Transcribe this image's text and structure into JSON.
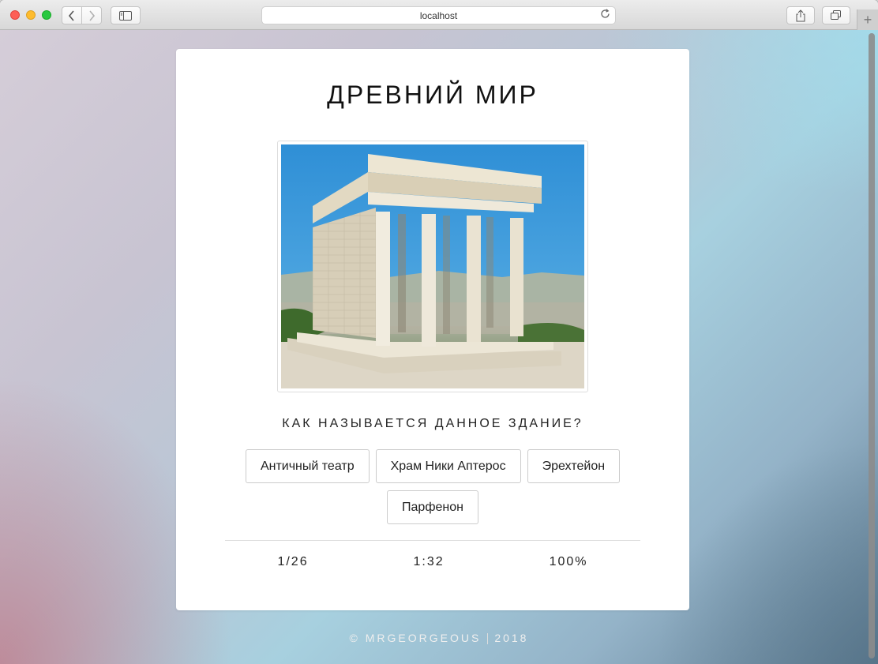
{
  "browser": {
    "address": "localhost",
    "icons": {
      "back": "chevron-left-icon",
      "forward": "chevron-right-icon",
      "sidebar": "sidebar-icon",
      "reload": "reload-icon",
      "share": "share-icon",
      "tabs": "tabs-icon",
      "new_tab": "plus-icon"
    }
  },
  "quiz": {
    "title": "ДРЕВНИЙ МИР",
    "question": "КАК НАЗЫВАЕТСЯ ДАННОЕ ЗДАНИЕ?",
    "answers": [
      "Античный театр",
      "Храм Ники Аптерос",
      "Эрехтейон",
      "Парфенон"
    ],
    "progress": "1/26",
    "timer": "1:32",
    "score": "100%"
  },
  "footer": {
    "copyright": "© MRGEORGEOUS",
    "year": "2018"
  }
}
